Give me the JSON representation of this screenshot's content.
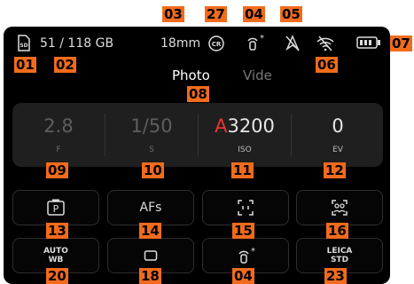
{
  "status": {
    "storage_label": "51 / 118 GB",
    "focal_length": "18mm",
    "sd_icon": "sd-card-icon",
    "crop_icon": "crop-mode-icon",
    "stabilization_icon": "hand-shake-icon",
    "location_icon": "gps-off-icon",
    "wifi_icon": "wifi-off-icon",
    "battery_icon": "battery-icon"
  },
  "tabs": {
    "photo": "Photo",
    "video": "Vide"
  },
  "exposure": {
    "aperture": {
      "value": "2.8",
      "label": "F"
    },
    "shutter": {
      "value": "1/50",
      "label": "S"
    },
    "iso": {
      "prefix": "A",
      "value": "3200",
      "label": "ISO"
    },
    "ev": {
      "value": "0",
      "label": "EV"
    }
  },
  "buttons_row1": {
    "mode": "P",
    "focus": "AFs",
    "metering_icon": "metering-icon",
    "drive_icon": "face-detection-icon"
  },
  "buttons_row2": {
    "wb_line1": "AUTO",
    "wb_line2": "WB",
    "format_icon": "format-rect-icon",
    "stabilization_icon": "hand-shake-icon",
    "leica_line1": "LEICA",
    "leica_line2": "STD"
  },
  "callouts": {
    "c01": "01",
    "c02": "02",
    "c03": "03",
    "c27": "27",
    "c04": "04",
    "c05": "05",
    "c06": "06",
    "c07": "07",
    "c08": "08",
    "c09": "09",
    "c10": "10",
    "c11": "11",
    "c12": "12",
    "c13": "13",
    "c14": "14",
    "c15": "15",
    "c16": "16",
    "c20": "20",
    "c18": "18",
    "c04b": "04",
    "c23": "23"
  },
  "colors": {
    "accent": "#f26b1d",
    "iso_auto": "#e53935",
    "screen": "#000000"
  }
}
